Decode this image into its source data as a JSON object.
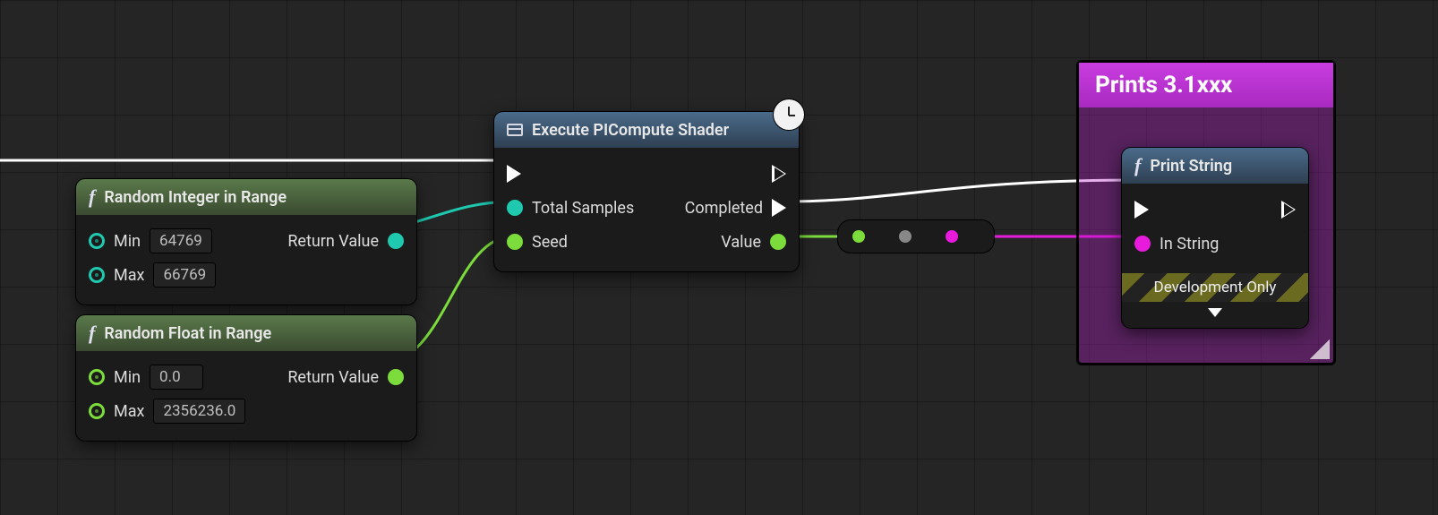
{
  "comment": {
    "title": "Prints 3.1xxx"
  },
  "nodes": {
    "randInt": {
      "title": "Random Integer in Range",
      "min_label": "Min",
      "min_value": "64769",
      "max_label": "Max",
      "max_value": "66769",
      "return_label": "Return Value"
    },
    "randFloat": {
      "title": "Random Float in Range",
      "min_label": "Min",
      "min_value": "0.0",
      "max_label": "Max",
      "max_value": "2356236.0",
      "return_label": "Return Value"
    },
    "execShader": {
      "title": "Execute PICompute Shader",
      "in_total": "Total Samples",
      "in_seed": "Seed",
      "out_completed": "Completed",
      "out_value": "Value"
    },
    "printString": {
      "title": "Print String",
      "in_string": "In String",
      "dev_label": "Development Only"
    }
  },
  "colors": {
    "int": "#1ec9b0",
    "float": "#7bdc3c",
    "string": "#e81adb",
    "comment": "#b63cd6"
  }
}
